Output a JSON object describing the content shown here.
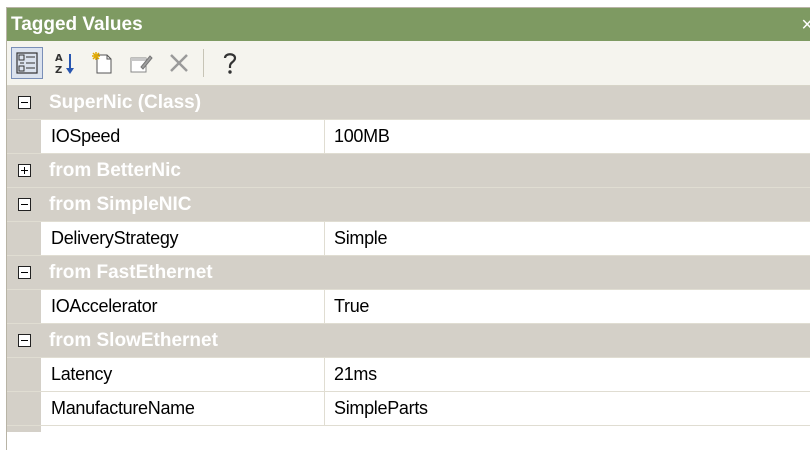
{
  "window": {
    "title": "Tagged Values",
    "close_glyph": "×"
  },
  "toolbar": {
    "buttons": [
      {
        "icon": "categorized-view-icon",
        "active": true
      },
      {
        "icon": "sort-alphabetical-icon",
        "active": false
      },
      {
        "icon": "new-tag-icon",
        "active": false
      },
      {
        "icon": "edit-tag-icon",
        "active": false
      },
      {
        "icon": "delete-icon",
        "active": false
      },
      {
        "icon": "help-icon",
        "active": false
      }
    ]
  },
  "groups": [
    {
      "label": "SuperNic (Class)",
      "expanded": true,
      "props": [
        {
          "name": "IOSpeed",
          "value": "100MB"
        }
      ]
    },
    {
      "label": "from BetterNic",
      "expanded": false,
      "props": []
    },
    {
      "label": "from SimpleNIC",
      "expanded": true,
      "props": [
        {
          "name": "DeliveryStrategy",
          "value": "Simple"
        }
      ]
    },
    {
      "label": "from FastEthernet",
      "expanded": true,
      "props": [
        {
          "name": "IOAccelerator",
          "value": "True"
        }
      ]
    },
    {
      "label": "from SlowEthernet",
      "expanded": true,
      "props": [
        {
          "name": "Latency",
          "value": "21ms"
        },
        {
          "name": "ManufactureName",
          "value": "SimpleParts"
        }
      ]
    }
  ],
  "colors": {
    "titlebar": "#7e9a62",
    "group_bg": "#d4d0c8",
    "group_text": "#ffffff"
  }
}
